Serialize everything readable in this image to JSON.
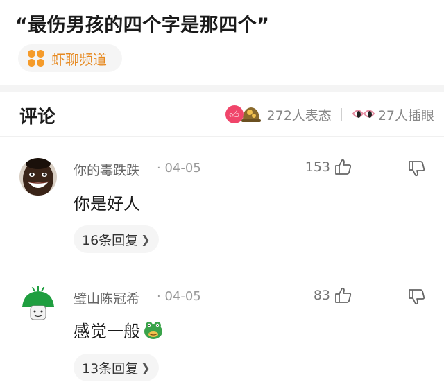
{
  "post": {
    "title": "“最伤男孩的四个字是那四个”",
    "channel": {
      "label": "虾聊频道",
      "icon": "flower-icon",
      "color": "#f59b2a"
    }
  },
  "comments_header": {
    "title": "评论",
    "reactions_text": "272人表态",
    "watch_text": "27人插眼"
  },
  "comments": [
    {
      "user": "你的毒跌跌",
      "date": "· 04-05",
      "likes": "153",
      "text": "你是好人",
      "replies": "16条回复",
      "emoji": ""
    },
    {
      "user": "璧山陈冠希",
      "date": "· 04-05",
      "likes": "83",
      "text": "感觉一般",
      "replies": "13条回复",
      "emoji": "frog-face-icon"
    }
  ],
  "colors": {
    "accent": "#e6881e",
    "like_red": "#f0456a",
    "muted": "#888888"
  }
}
